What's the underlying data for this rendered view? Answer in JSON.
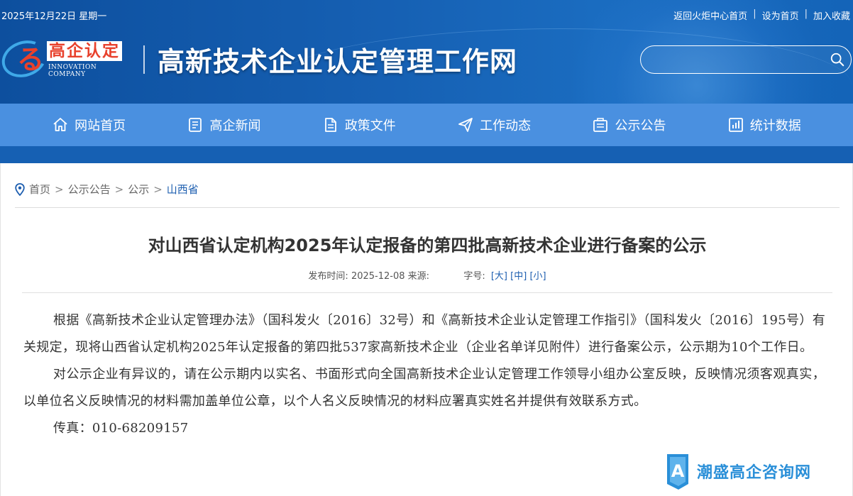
{
  "topbar": {
    "date": "2025年12月22日 星期一",
    "links": [
      "返回火炬中心首页",
      "设为首页",
      "加入收藏"
    ],
    "separator": "|"
  },
  "logo": {
    "figure": "る",
    "cn": "高企认定",
    "en": "INNOVATION COMPANY"
  },
  "site_title": "高新技术企业认定管理工作网",
  "search": {
    "placeholder": "",
    "icon": "search-icon"
  },
  "nav": {
    "items": [
      {
        "label": "网站首页",
        "icon": "home-icon"
      },
      {
        "label": "高企新闻",
        "icon": "news-icon"
      },
      {
        "label": "政策文件",
        "icon": "document-icon"
      },
      {
        "label": "工作动态",
        "icon": "send-icon"
      },
      {
        "label": "公示公告",
        "icon": "notice-icon"
      },
      {
        "label": "统计数据",
        "icon": "chart-icon"
      }
    ]
  },
  "breadcrumb": {
    "items": [
      "首页",
      "公示公告",
      "公示",
      "山西省"
    ],
    "separator": ">"
  },
  "article": {
    "title": "对山西省认定机构2025年认定报备的第四批高新技术企业进行备案的公示",
    "meta": {
      "publish_label": "发布时间:",
      "publish_date": "2025-12-08",
      "source_label": "来源:",
      "source": "",
      "font_label": "字号:",
      "sizes": [
        "[大]",
        "[中]",
        "[小]"
      ]
    },
    "paragraphs": [
      "根据《高新技术企业认定管理办法》（国科发火〔2016〕32号）和《高新技术企业认定管理工作指引》（国科发火〔2016〕195号）有关规定，现将山西省认定机构2025年认定报备的第四批537家高新技术企业（企业名单详见附件）进行备案公示，公示期为10个工作日。",
      "对公示企业有异议的，请在公示期内以实名、书面形式向全国高新技术企业认定管理工作领导小组办公室反映，反映情况须客观真实，以单位名义反映情况的材料需加盖单位公章，以个人名义反映情况的材料应署真实姓名并提供有效联系方式。"
    ],
    "fax": "传真：010-68209157"
  },
  "watermark": {
    "text": "潮盛高企咨询网",
    "letter": "A"
  },
  "colors": {
    "header_blue": "#1660b3",
    "nav_blue": "#4a90e0",
    "logo_red": "#e8412c",
    "link_blue": "#1e5fb0",
    "watermark_blue": "#2a8fd8"
  }
}
